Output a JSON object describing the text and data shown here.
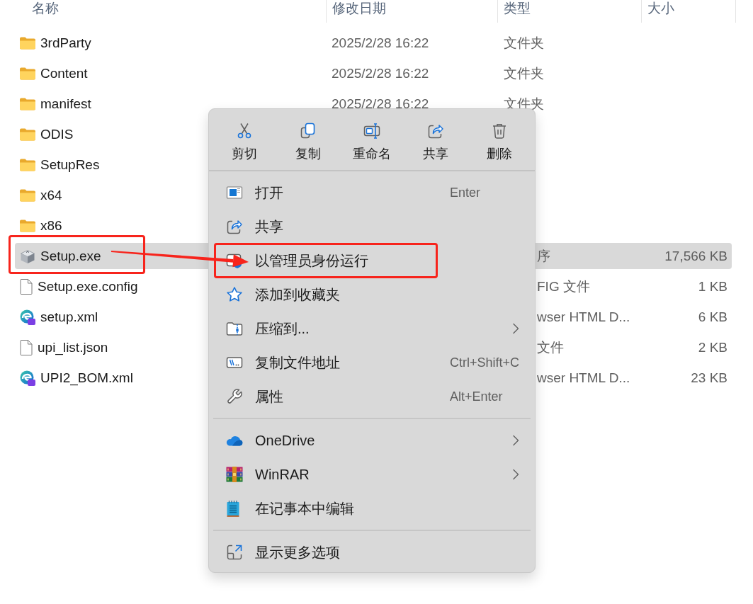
{
  "columns": [
    {
      "label": "名称"
    },
    {
      "label": "修改日期"
    },
    {
      "label": "类型"
    },
    {
      "label": "大小"
    }
  ],
  "files": [
    {
      "name": "3rdParty",
      "kind": "folder",
      "date": "2025/2/28 16:22",
      "type": "文件夹",
      "selected": false,
      "marked": false
    },
    {
      "name": "Content",
      "kind": "folder",
      "date": "2025/2/28 16:22",
      "type": "文件夹",
      "selected": false,
      "marked": false
    },
    {
      "name": "manifest",
      "kind": "folder",
      "date": "2025/2/28 16:22",
      "type": "文件夹",
      "selected": false,
      "marked": false
    },
    {
      "name": "ODIS",
      "kind": "folder",
      "selected": false,
      "marked": false
    },
    {
      "name": "SetupRes",
      "kind": "folder",
      "selected": false,
      "marked": false
    },
    {
      "name": "x64",
      "kind": "folder",
      "selected": false,
      "marked": false
    },
    {
      "name": "x86",
      "kind": "folder",
      "selected": false,
      "marked": false
    },
    {
      "name": "Setup.exe",
      "kind": "package",
      "type": "序",
      "size": "17,566 KB",
      "selected": true,
      "marked": true
    },
    {
      "name": "Setup.exe.config",
      "kind": "document",
      "type": "FIG 文件",
      "size": "1 KB",
      "selected": false,
      "marked": false
    },
    {
      "name": "setup.xml",
      "kind": "browser-file",
      "type": "wser HTML D...",
      "size": "6 KB",
      "selected": false,
      "marked": false
    },
    {
      "name": "upi_list.json",
      "kind": "document",
      "type": "文件",
      "size": "2 KB",
      "selected": false,
      "marked": false
    },
    {
      "name": "UPI2_BOM.xml",
      "kind": "browser-file",
      "type": "wser HTML D...",
      "size": "23 KB",
      "selected": false,
      "marked": false
    }
  ],
  "context_menu": {
    "actions": [
      {
        "label": "剪切",
        "kind": "cut"
      },
      {
        "label": "复制",
        "kind": "copy"
      },
      {
        "label": "重命名",
        "kind": "rename"
      },
      {
        "label": "共享",
        "kind": "share"
      },
      {
        "label": "删除",
        "kind": "delete"
      }
    ],
    "groups": [
      {
        "items": [
          {
            "label": "打开",
            "kind": "open",
            "shortcut": "Enter",
            "submenu": false,
            "marked": false
          },
          {
            "label": "共享",
            "kind": "share",
            "submenu": false,
            "marked": false
          },
          {
            "label": "以管理员身份运行",
            "kind": "admin",
            "submenu": false,
            "marked": true
          },
          {
            "label": "添加到收藏夹",
            "kind": "favorite",
            "submenu": false,
            "marked": false
          },
          {
            "label": "压缩到...",
            "kind": "compress",
            "submenu": true,
            "marked": false
          },
          {
            "label": "复制文件地址",
            "kind": "copy-path",
            "shortcut": "Ctrl+Shift+C",
            "submenu": false,
            "marked": false
          },
          {
            "label": "属性",
            "kind": "properties",
            "shortcut": "Alt+Enter",
            "submenu": false,
            "marked": false
          }
        ]
      },
      {
        "items": [
          {
            "label": "OneDrive",
            "kind": "onedrive",
            "submenu": true,
            "marked": false
          },
          {
            "label": "WinRAR",
            "kind": "winrar",
            "submenu": true,
            "marked": false
          },
          {
            "label": "在记事本中编辑",
            "kind": "notepad",
            "submenu": false,
            "marked": false
          }
        ]
      },
      {
        "items": [
          {
            "label": "显示更多选项",
            "kind": "more",
            "submenu": false,
            "marked": false
          }
        ]
      }
    ]
  }
}
